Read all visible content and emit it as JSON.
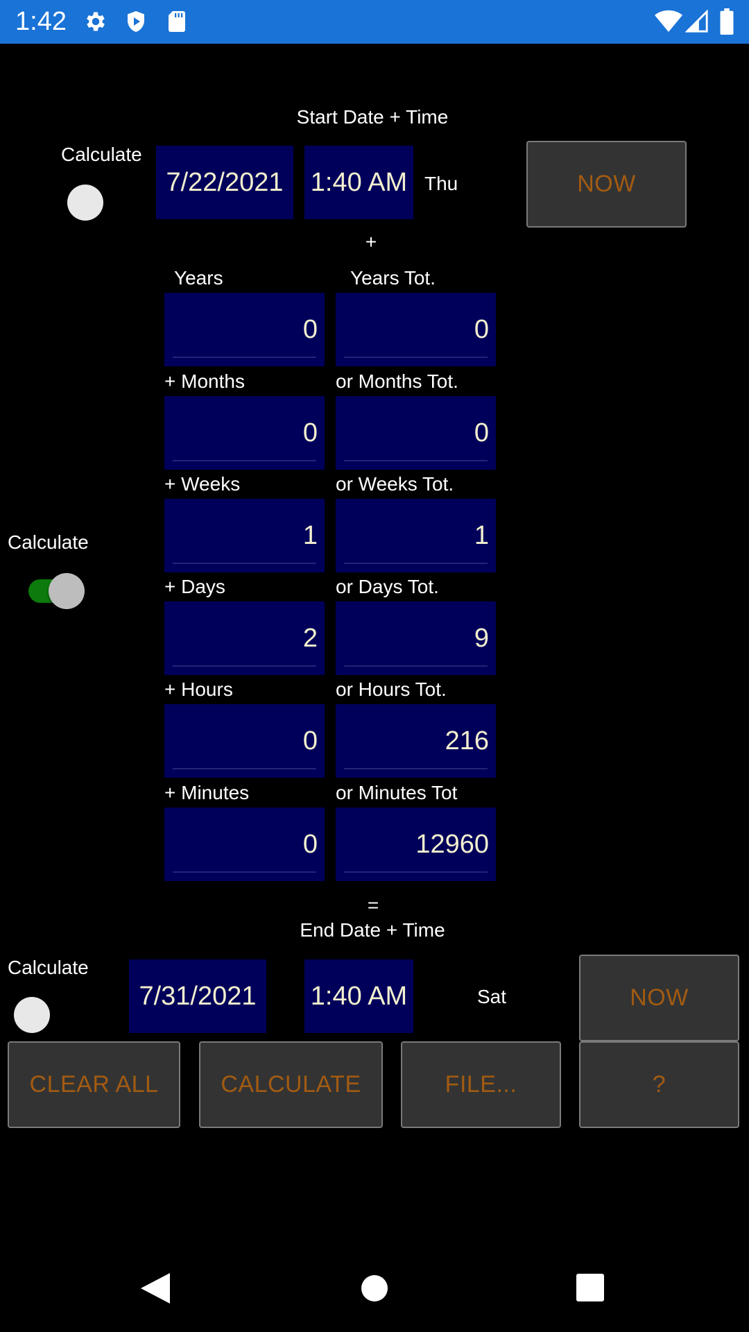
{
  "status_bar": {
    "time": "1:42",
    "icons_left": [
      "gear-icon",
      "shield-play-icon",
      "sd-card-icon"
    ],
    "icons_right": [
      "wifi-icon",
      "cellular-signal-icon",
      "battery-icon"
    ],
    "background": "#1a73d6"
  },
  "start": {
    "title": "Start Date + Time",
    "calculate_label": "Calculate",
    "toggle_on": false,
    "date": "7/22/2021",
    "time": "1:40 AM",
    "weekday": "Thu",
    "now_label": "NOW"
  },
  "plus_sign": "+",
  "duration": {
    "calculate_label": "Calculate",
    "toggle_on": true,
    "rows": [
      {
        "left_label": "Years",
        "right_label": "Years Tot.",
        "left_value": "0",
        "right_value": "0"
      },
      {
        "left_label": "+ Months",
        "right_label": "or Months Tot.",
        "left_value": "0",
        "right_value": "0"
      },
      {
        "left_label": "+ Weeks",
        "right_label": "or Weeks Tot.",
        "left_value": "1",
        "right_value": "1"
      },
      {
        "left_label": "+ Days",
        "right_label": "or Days Tot.",
        "left_value": "2",
        "right_value": "9"
      },
      {
        "left_label": "+ Hours",
        "right_label": "or Hours Tot.",
        "left_value": "0",
        "right_value": "216"
      },
      {
        "left_label": "+ Minutes",
        "right_label": "or Minutes Tot",
        "left_value": "0",
        "right_value": "12960"
      }
    ]
  },
  "equals_sign": "=",
  "end": {
    "title": "End Date + Time",
    "calculate_label": "Calculate",
    "toggle_on": false,
    "date": "7/31/2021",
    "time": "1:40 AM",
    "weekday": "Sat",
    "now_label": "NOW"
  },
  "actions": {
    "clear_all": "CLEAR ALL",
    "calculate": "CALCULATE",
    "file": "FILE...",
    "help": "?"
  },
  "nav_bar": {
    "icons": [
      "back-triangle-icon",
      "home-circle-icon",
      "recents-square-icon"
    ]
  },
  "colors": {
    "field_bg": "#00005a",
    "field_text": "#f3f0cf",
    "button_bg": "#333333",
    "button_text": "#a25b12",
    "toggle_on": "#0c7a0c"
  }
}
